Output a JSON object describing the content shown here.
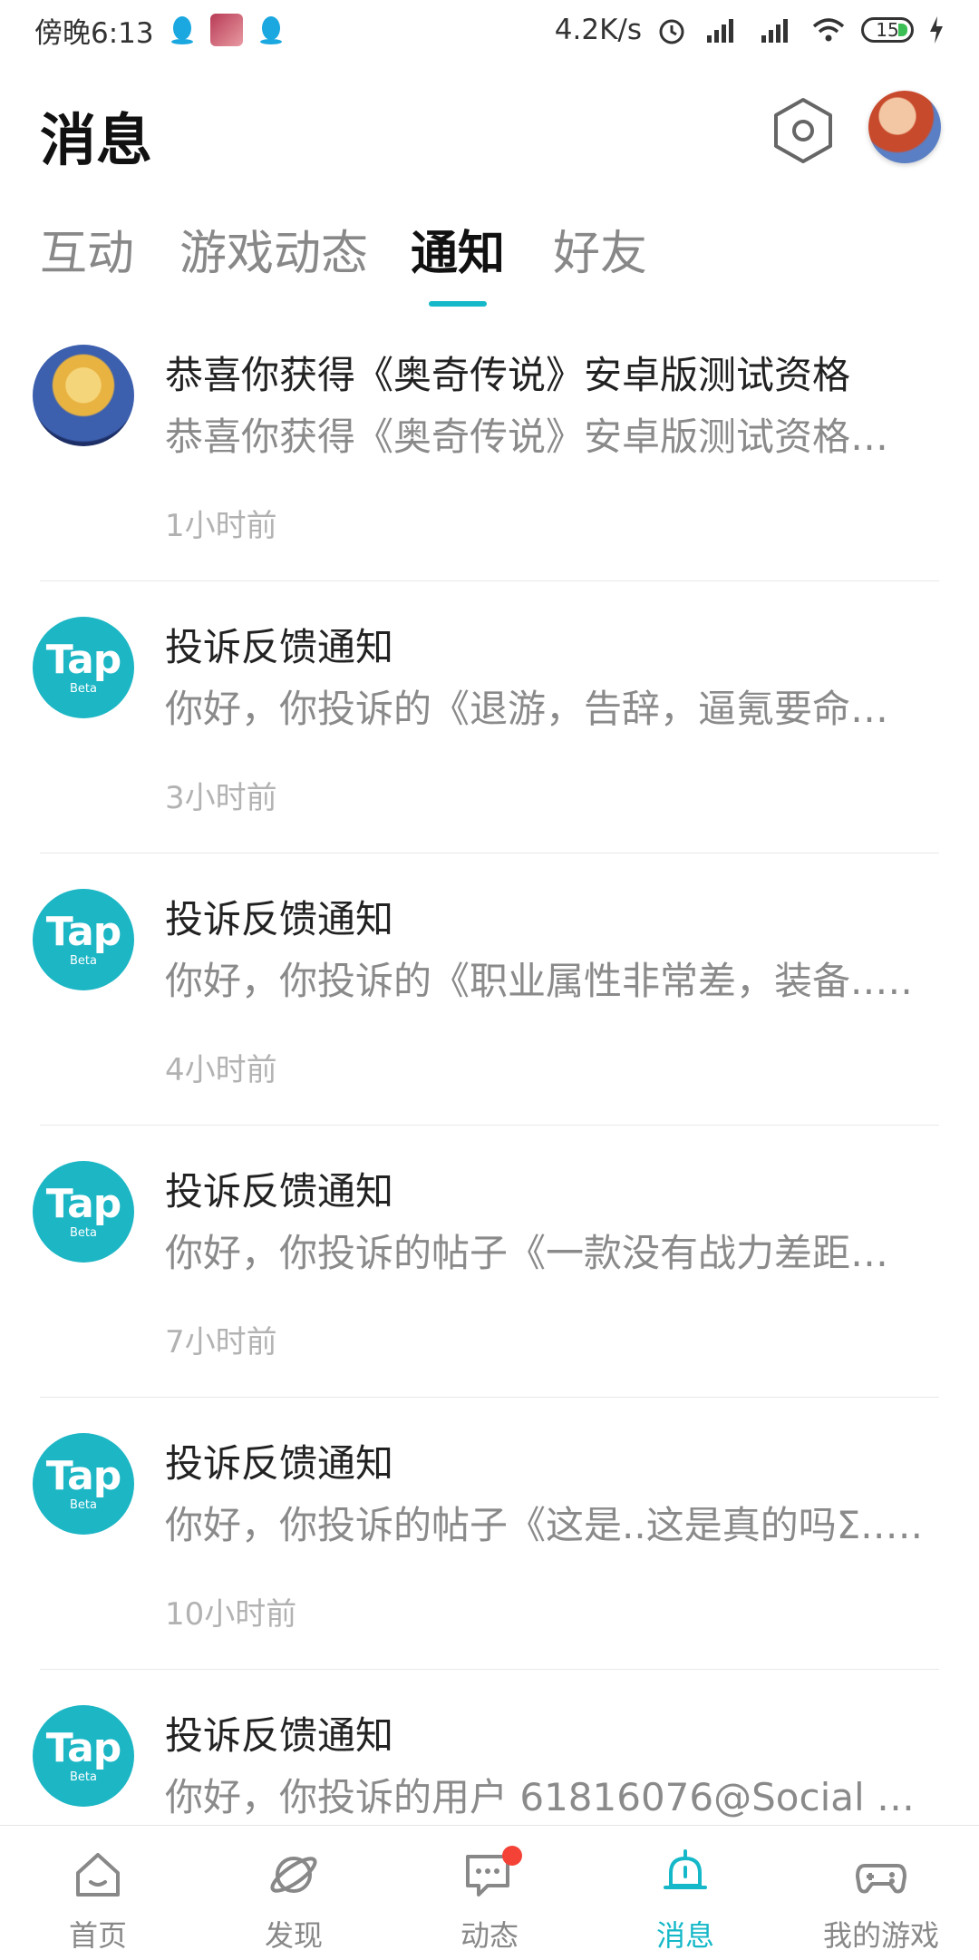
{
  "status_bar": {
    "time": "傍晚6:13",
    "speed": "4.2K/s",
    "battery": "15"
  },
  "header": {
    "title": "消息"
  },
  "tabs": [
    {
      "label": "互动",
      "active": false
    },
    {
      "label": "游戏动态",
      "active": false
    },
    {
      "label": "通知",
      "active": true
    },
    {
      "label": "好友",
      "active": false
    }
  ],
  "notifications": [
    {
      "avatar": "game-avatar",
      "title": "恭喜你获得《奥奇传说》安卓版测试资格",
      "body": "恭喜你获得《奥奇传说》安卓版测试资格…",
      "time": "1小时前"
    },
    {
      "avatar": "tap-logo",
      "title": "投诉反馈通知",
      "body": "你好，你投诉的《退游，告辞，逼氪要命…",
      "time": "3小时前"
    },
    {
      "avatar": "tap-logo",
      "title": "投诉反馈通知",
      "body": "你好，你投诉的《职业属性非常差，装备.….",
      "time": "4小时前"
    },
    {
      "avatar": "tap-logo",
      "title": "投诉反馈通知",
      "body": "你好，你投诉的帖子《一款没有战力差距…",
      "time": "7小时前"
    },
    {
      "avatar": "tap-logo",
      "title": "投诉反馈通知",
      "body": "你好，你投诉的帖子《这是..这是真的吗Σ.….",
      "time": "10小时前"
    },
    {
      "avatar": "tap-logo",
      "title": "投诉反馈通知",
      "body": "你好，你投诉的用户 61816076@Social 相…",
      "time": ""
    }
  ],
  "tap_logo": {
    "text": "Tap",
    "sub": "Beta"
  },
  "bottom_nav": [
    {
      "label": "首页",
      "icon": "home-icon",
      "active": false
    },
    {
      "label": "发现",
      "icon": "planet-icon",
      "active": false
    },
    {
      "label": "动态",
      "icon": "chat-icon",
      "active": false,
      "badge": true
    },
    {
      "label": "消息",
      "icon": "bell-icon",
      "active": true
    },
    {
      "label": "我的游戏",
      "icon": "gamepad-icon",
      "active": false
    }
  ],
  "colors": {
    "accent": "#15b8c8",
    "badge": "#f44336"
  }
}
